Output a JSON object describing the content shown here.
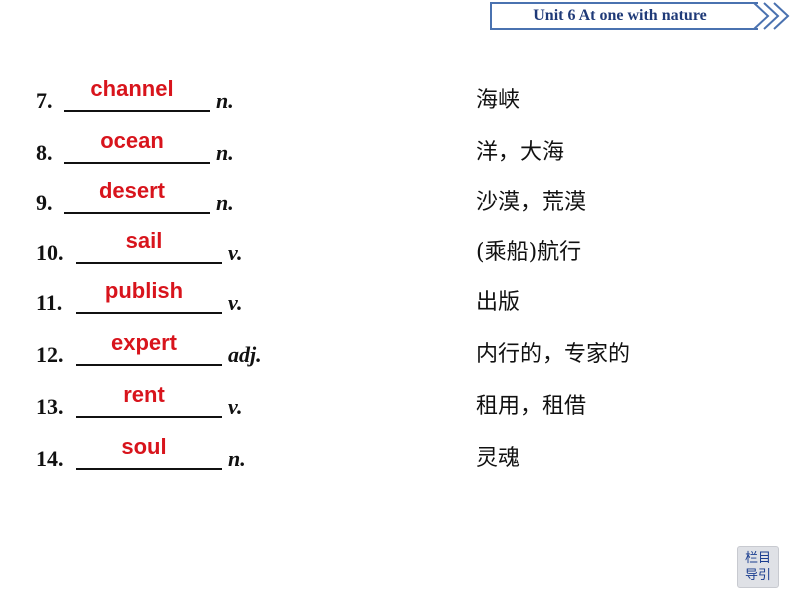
{
  "header": {
    "unit_title": "Unit 6    At one with nature"
  },
  "items": [
    {
      "number": "7.",
      "answer": "channel",
      "pos": "n.",
      "meaning": "海峡"
    },
    {
      "number": "8.",
      "answer": "ocean",
      "pos": "n.",
      "meaning": "洋，大海"
    },
    {
      "number": "9.",
      "answer": "desert",
      "pos": "n.",
      "meaning": "沙漠，荒漠"
    },
    {
      "number": "10.",
      "answer": "sail",
      "pos": "v.",
      "meaning": "(乘船)航行"
    },
    {
      "number": "11.",
      "answer": "publish",
      "pos": "v.",
      "meaning": "出版"
    },
    {
      "number": "12.",
      "answer": "expert",
      "pos": "adj.",
      "meaning": "内行的，专家的"
    },
    {
      "number": "13.",
      "answer": "rent",
      "pos": "v.",
      "meaning": "租用，租借"
    },
    {
      "number": "14.",
      "answer": "soul",
      "pos": "n.",
      "meaning": "灵魂"
    }
  ],
  "nav_button": {
    "line1": "栏目",
    "line2": "导引"
  },
  "colors": {
    "answer": "#d8141c",
    "banner_border": "#4a72b0",
    "banner_text": "#1f3a78"
  }
}
